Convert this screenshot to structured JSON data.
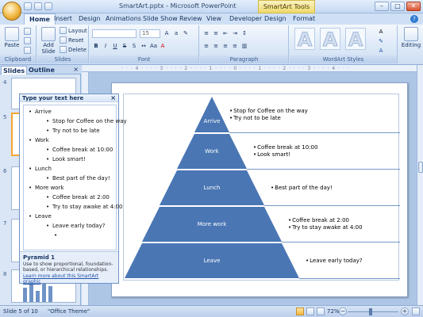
{
  "window": {
    "title": "SmartArt.pptx - Microsoft PowerPoint",
    "context_tab": "SmartArt Tools",
    "minimize": "–",
    "maximize": "□",
    "close": "✕"
  },
  "tabs": [
    "Home",
    "Insert",
    "Design",
    "Animations",
    "Slide Show",
    "Review",
    "View",
    "Developer",
    "Design",
    "Format"
  ],
  "ribbon": {
    "groups": [
      "Clipboard",
      "Slides",
      "Font",
      "Paragraph",
      "WordArt Styles",
      "Editing"
    ],
    "paste_label": "Paste",
    "add_slide_label": "Add Slide",
    "layout_label": "Layout",
    "reset_label": "Reset",
    "delete_label": "Delete",
    "font_name": "",
    "font_size": "15",
    "editing_label": "Editing",
    "wordart_letter": "A"
  },
  "left_pane": {
    "tab_slides": "Slides",
    "tab_outline": "Outline",
    "close": "×",
    "thumb_numbers": [
      "4",
      "5",
      "6",
      "7",
      "8"
    ]
  },
  "text_pane": {
    "header": "Type your text here",
    "close": "×",
    "items": [
      {
        "text": "Arrive",
        "level": 1
      },
      {
        "text": "Stop for Coffee on the way",
        "level": 2
      },
      {
        "text": "Try not to be late",
        "level": 2
      },
      {
        "text": "Work",
        "level": 1
      },
      {
        "text": "Coffee break at 10:00",
        "level": 2
      },
      {
        "text": "Look smart!",
        "level": 2
      },
      {
        "text": "Lunch",
        "level": 1
      },
      {
        "text": "Best part of the day!",
        "level": 2
      },
      {
        "text": "More work",
        "level": 1
      },
      {
        "text": "Coffee break at 2:00",
        "level": 2
      },
      {
        "text": "Try to stay awake at 4:00",
        "level": 2
      },
      {
        "text": "Leave",
        "level": 1
      },
      {
        "text": "Leave early today?",
        "level": 2
      },
      {
        "text": "",
        "level": 3
      }
    ],
    "layout_name": "Pyramid 1",
    "description": "Use to show proportional, foundation-based, or hierarchical relationships.",
    "learn_more": "Learn more about this SmartArt graphic"
  },
  "pyramid": {
    "color": "#4a76b4",
    "levels": [
      {
        "label": "Arrive",
        "notes": [
          "Stop for Coffee on the way",
          "Try not to be late"
        ]
      },
      {
        "label": "Work",
        "notes": [
          "Coffee break at 10:00",
          "Look smart!"
        ]
      },
      {
        "label": "Lunch",
        "notes": [
          "Best part of the day!"
        ]
      },
      {
        "label": "More work",
        "notes": [
          "Coffee break at 2:00",
          "Try to stay awake at 4:00"
        ]
      },
      {
        "label": "Leave",
        "notes": [
          "Leave early today?"
        ]
      }
    ]
  },
  "ruler_text": "· · · 4 · · · · 3 · · · · 2 · · · · 1 · · · · 0 · · · · 1 · · · · 2 · · · · 3 · · · · 4 · · ·",
  "status": {
    "slide_info": "Slide 5 of 10",
    "theme": "\"Office Theme\"",
    "zoom": "72%",
    "zoom_fraction": 0.45,
    "zoom_out": "−",
    "zoom_in": "+"
  }
}
